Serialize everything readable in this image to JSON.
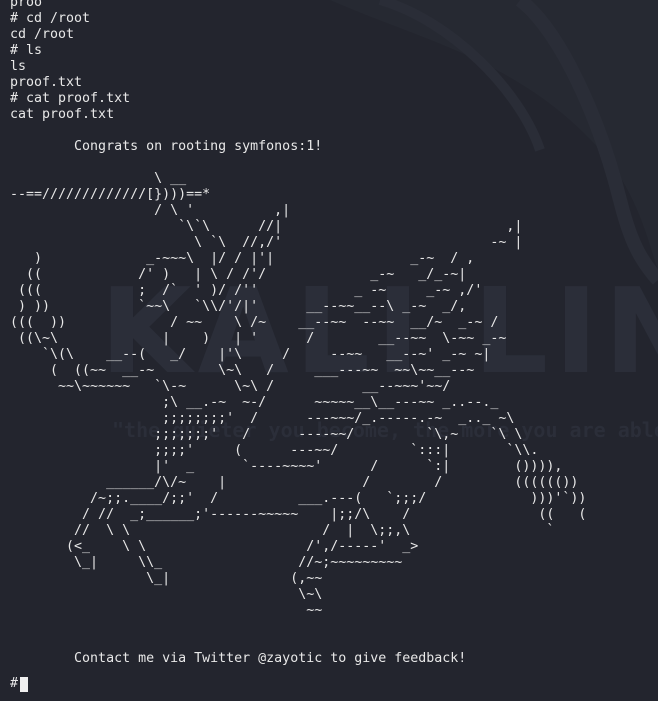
{
  "terminal": {
    "wallpaper_word": "KALI LINUX",
    "wallpaper_slogan": "\"the quieter you become, the more you are able to hear\"",
    "lines": [
      "proo",
      "# cd /root",
      "cd /root",
      "# ls",
      "ls",
      "proof.txt",
      "# cat proof.txt",
      "cat proof.txt",
      "",
      "        Congrats on rooting symfonos:1!",
      ""
    ],
    "ascii_art": "                  \\ __\n--==/////////////[})))==*\n                  / \\ '          ,|\n                     `\\`\\      //|                            ,|\n                       \\ `\\  //,/'                          -~ |\n   )             _-~~~\\  |/ / |'|                 _-~  / ,\n  ((            /' )   | \\ / /'/             _-~   _/_-~|\n (((            ;  /`  ' )/ /''            _ -~     _-~ ,/'\n ) ))           `~~\\   `\\\\/'/|'      __--~~__--\\ _-~  _/,\n(((  ))             / ~~    \\ /~    __--~~  --~~  __/~  _-~ /\n ((\\~\\             |    )   | '      /        __--~~  \\-~~ _-~\n    `\\(\\    __--(   _/    |'\\     /     --~~   __--~' _-~ ~|\n     (  ((~~  __-~        \\~\\   /     ___---~~  ~~\\~~__--~\n      ~~\\~~~~~~   `\\-~      \\~\\ /           __--~~~'~~/\n                   ;\\ __.-~  ~-/      ~~~~~__\\__---~~ _..--._\n                   ;;;;;;;;'  /      ---~~~/_.-----.-~  _.._ ~\\\n                  ;;;;;;;'   /      ----~~/         `\\,~    `\\ \\\n                  ;;;;'     (      ---~~/         `:::|       `\\\\.\n                  |'  _      `----~~~~'      /      `:|        ()))),\n            ______/\\/~    |                 /        /         (((((())\n          /~;;.____/;;'  /          ___.---(   `;;;/             )))'`))\n         / //  _;______;'------~~~~~    |;;/\\    /                ((   (\n        //  \\ \\                        /  |  \\;;,\\                 `\n       (<_    \\ \\                    /',/-----'  _>\n        \\_|     \\\\_                 //~;~~~~~~~~~\n                 \\_|               (,~~\n                                    \\~\\\n                                     ~~",
    "feedback_line": "        Contact me via Twitter @zayotic to give feedback!",
    "prompt": "#"
  }
}
